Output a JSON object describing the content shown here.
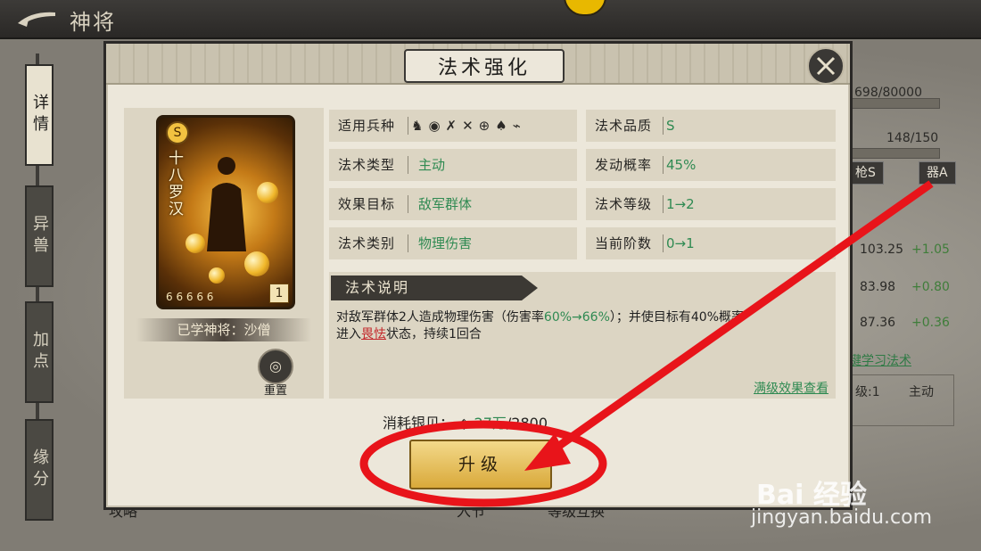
{
  "topbar": {
    "title": "神将"
  },
  "side_tabs": [
    {
      "label": "详情",
      "active": true
    },
    {
      "label": "异兽",
      "active": false
    },
    {
      "label": "加点",
      "active": false
    },
    {
      "label": "缘分",
      "active": false
    }
  ],
  "background": {
    "exp_text": "698/80000",
    "level_text": "148/150",
    "tag1": "枪S",
    "tag2": "器A",
    "stats": [
      {
        "value": "103.25",
        "delta": "+1.05"
      },
      {
        "value": "83.98",
        "delta": "+0.80"
      },
      {
        "value": "87.36",
        "delta": "+0.36"
      }
    ],
    "link": "键学习法术",
    "small_left": "级:1",
    "small_right": "主动",
    "bottom_left": "攻略",
    "bottom_mid": "入节",
    "bottom_right": "等级互换"
  },
  "modal": {
    "title": "法术强化",
    "hero": {
      "name": "十八罗汉",
      "badge": "S",
      "level": "1",
      "stars": "6 6 6 6 6",
      "learned_text": "已学神将：沙僧",
      "reset_label": "重置",
      "reset_icon": "swirl-icon"
    },
    "attributes_left": [
      {
        "key": "适用兵种",
        "value": ""
      },
      {
        "key": "法术类型",
        "value": "主动"
      },
      {
        "key": "效果目标",
        "value": "敌军群体"
      },
      {
        "key": "法术类别",
        "value": "物理伤害"
      }
    ],
    "attributes_right": [
      {
        "key": "法术品质",
        "value": "S"
      },
      {
        "key": "发动概率",
        "value": "45%"
      },
      {
        "key": "法术等级",
        "value": "1→2"
      },
      {
        "key": "当前阶数",
        "value": "0→1"
      }
    ],
    "unit_icons": [
      "horse-icon",
      "shield-icon",
      "bow-icon",
      "crossed-swords-icon",
      "crosshair-icon",
      "fan-icon",
      "cannon-icon"
    ],
    "description": {
      "title": "法术说明",
      "text_a": "对敌军群体2人造成物理伤害（伤害率",
      "text_g": "60%→66%",
      "text_b": "）；并使目标有40%概率",
      "text_c": "进入",
      "text_r": "畏怯",
      "text_d": "状态，持续1回合",
      "max_link": "满级效果查看"
    },
    "cost": {
      "label": "消耗银贝：",
      "value": "27万",
      "total": "/2800"
    },
    "upgrade_label": "升级"
  },
  "watermark": {
    "main": "Bai 经验",
    "sub": "jingyan.baidu.com"
  },
  "colors": {
    "accent_green": "#2f8a52",
    "annotation_red": "#e8141a",
    "gold": "#d9a93a"
  }
}
